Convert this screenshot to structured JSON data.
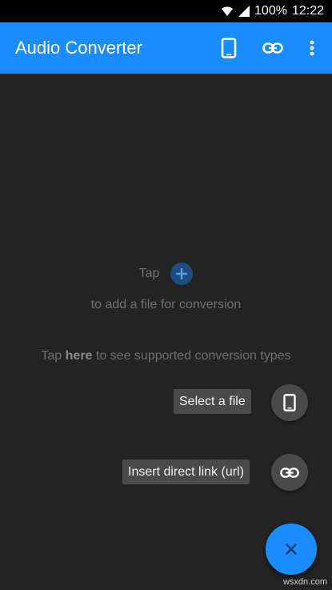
{
  "status_bar": {
    "battery": "100%",
    "time": "12:22"
  },
  "app_bar": {
    "title": "Audio Converter",
    "icons": [
      "phone-icon",
      "link-icon",
      "more-vert-icon"
    ]
  },
  "empty_state": {
    "tap": "Tap",
    "add_text": "to add a file for conversion",
    "types_prefix": "Tap",
    "types_link": "here",
    "types_suffix": "to see supported conversion types"
  },
  "fab_menu": {
    "select_file_label": "Select a file",
    "insert_link_label": "Insert direct link (url)"
  },
  "watermark": "wsxdn.com",
  "colors": {
    "accent": "#1a8cff",
    "background": "#232323",
    "status_bar": "#000000"
  }
}
